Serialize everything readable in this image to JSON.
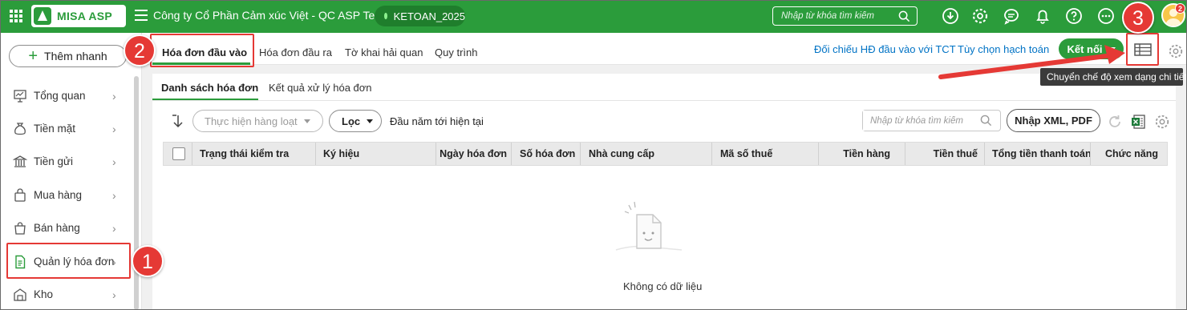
{
  "app": {
    "logo_text": "MISA ASP",
    "company_name": "Công ty Cổ Phần Cảm xúc Việt - QC ASP Test",
    "database": "KETOAN_2025",
    "search_placeholder": "Nhập từ khóa tìm kiếm",
    "notification_count": "2",
    "colors": {
      "brand": "#2b9c3b",
      "link": "#0073c5",
      "annotation": "#e53935"
    }
  },
  "sidebar": {
    "add_button": "Thêm nhanh",
    "items": [
      {
        "label": "Tổng quan",
        "icon": "chart-board-icon"
      },
      {
        "label": "Tiền mặt",
        "icon": "money-bag-icon"
      },
      {
        "label": "Tiền gửi",
        "icon": "bank-icon"
      },
      {
        "label": "Mua hàng",
        "icon": "shopping-bag-icon"
      },
      {
        "label": "Bán hàng",
        "icon": "sales-bag-icon"
      },
      {
        "label": "Quản lý hóa đơn",
        "icon": "invoice-icon"
      },
      {
        "label": "Kho",
        "icon": "warehouse-icon"
      }
    ]
  },
  "main": {
    "tabs": [
      "Hóa đơn đầu vào",
      "Hóa đơn đầu ra",
      "Tờ khai hải quan",
      "Quy trình"
    ],
    "links": {
      "reconcile": "Đối chiếu HĐ đầu vào với TCT",
      "accounting_options": "Tùy chọn hạch toán"
    },
    "connect_button": "Kết nối",
    "tooltip": "Chuyển chế độ xem dạng chi tiết"
  },
  "subtabs": [
    "Danh sách hóa đơn",
    "Kết quả xử lý hóa đơn"
  ],
  "toolbar": {
    "batch_button": "Thực hiện hàng loạt",
    "filter_button": "Lọc",
    "period": "Đầu năm tới hiện tại",
    "search_placeholder": "Nhập từ khóa tìm kiếm",
    "import_button": "Nhập XML, PDF"
  },
  "table": {
    "columns": [
      "Trạng thái kiểm tra",
      "Ký hiệu",
      "Ngày hóa đơn",
      "Số hóa đơn",
      "Nhà cung cấp",
      "Mã số thuế",
      "Tiền hàng",
      "Tiền thuế",
      "Tổng tiền thanh toán",
      "Chức năng"
    ],
    "empty_text": "Không có dữ liệu"
  },
  "annotations": {
    "step1": "1",
    "step2": "2",
    "step3": "3"
  }
}
